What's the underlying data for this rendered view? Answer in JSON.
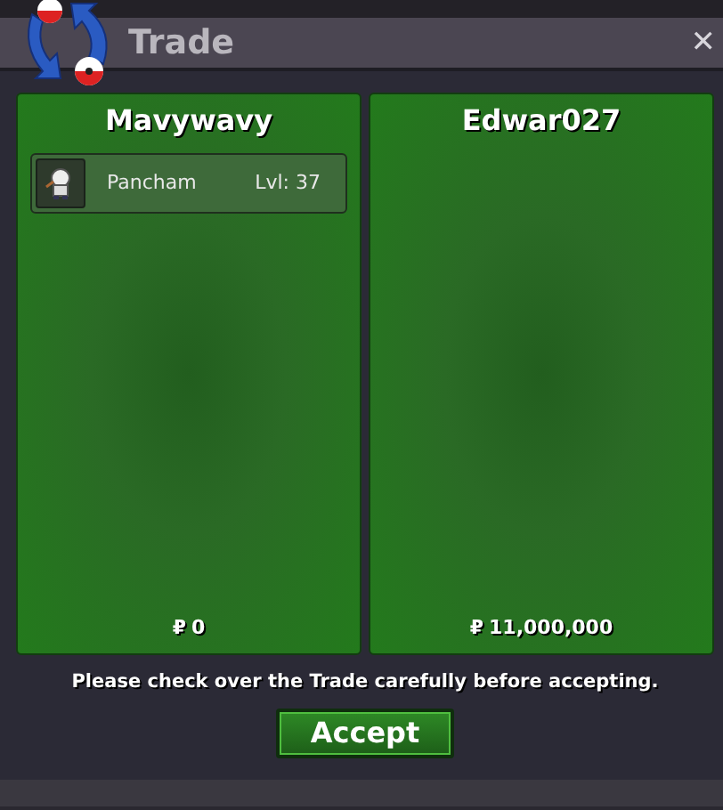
{
  "window": {
    "title": "Trade",
    "close": "✕"
  },
  "offers": [
    {
      "player": "Mavywavy",
      "items": [
        {
          "name": "Pancham",
          "level": "Lvl: 37"
        }
      ],
      "currency": "₽",
      "money": "0"
    },
    {
      "player": "Edwar027",
      "currency": "₽",
      "money": "11,000,000"
    }
  ],
  "notice": "Please check over the Trade carefully before accepting.",
  "button": "Accept"
}
